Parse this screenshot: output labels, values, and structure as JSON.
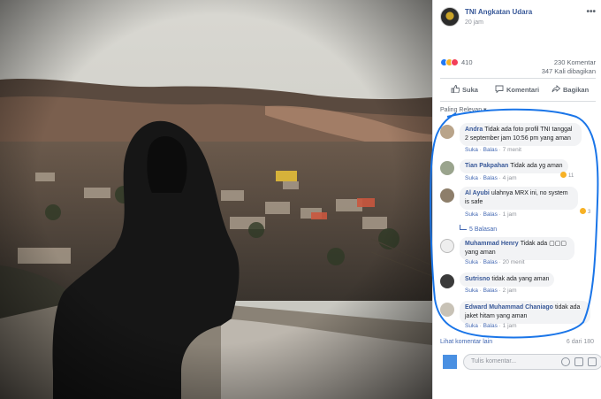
{
  "post": {
    "page_name": "TNI Angkatan Udara",
    "time": "20 jam",
    "more": "•••",
    "reactions_count": "410",
    "comments_count": "230 Komentar",
    "shares_count": "347 Kali dibagikan"
  },
  "actions": {
    "like": "Suka",
    "comment": "Komentari",
    "share": "Bagikan"
  },
  "sort_label": "Paling Relevan ▾",
  "comments": [
    {
      "author": "Andra",
      "text": "Tidak ada foto profil TNI tanggal 2 september jam 10:56 pm yang aman",
      "like": "Suka",
      "reply": "Balas",
      "time": "7 menit",
      "reactions": ""
    },
    {
      "author": "Tian Pakpahan",
      "text": "Tidak ada yg aman",
      "like": "Suka",
      "reply": "Balas",
      "time": "4 jam",
      "reactions": "11"
    },
    {
      "author": "Al Ayubi",
      "text": "ulahnya MRX ini, no system is safe",
      "like": "Suka",
      "reply": "Balas",
      "time": "1 jam",
      "reactions": "3"
    },
    {
      "author": "Muhammad Henry",
      "text": "Tidak ada ▢▢▢ yang aman",
      "like": "Suka",
      "reply": "Balas",
      "time": "20 menit",
      "reactions": ""
    },
    {
      "author": "Sutrisno",
      "text": "tidak ada yang aman",
      "like": "Suka",
      "reply": "Balas",
      "time": "2 jam",
      "reactions": ""
    },
    {
      "author": "Edward Muhammad Chaniago",
      "text": "tidak ada jaket hitam yang aman",
      "like": "Suka",
      "reply": "Balas",
      "time": "1 jam",
      "reactions": ""
    }
  ],
  "replies_link": "5 Balasan",
  "footer": {
    "more_comments": "Lihat komentar lain",
    "pagination": "6 dari 180"
  },
  "composer": {
    "placeholder": "Tulis komentar..."
  },
  "colors": {
    "link": "#385898",
    "annotation": "#1a75e8",
    "bubble": "#f2f3f5"
  }
}
